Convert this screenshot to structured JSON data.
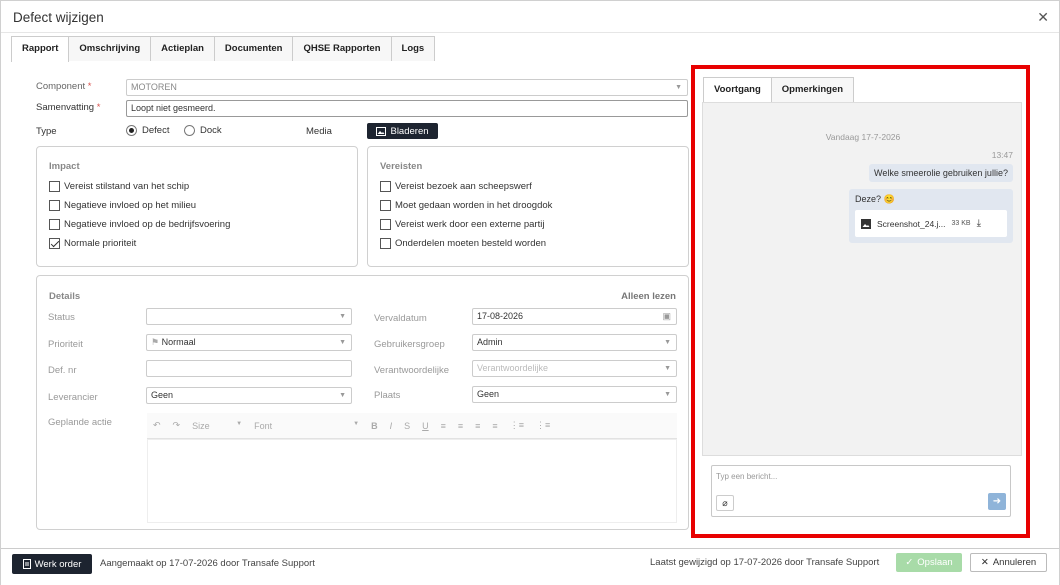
{
  "window": {
    "title": "Defect wijzigen",
    "close_icon": "close-icon"
  },
  "tabs": [
    {
      "label": "Rapport",
      "active": true
    },
    {
      "label": "Omschrijving"
    },
    {
      "label": "Actieplan"
    },
    {
      "label": "Documenten"
    },
    {
      "label": "QHSE Rapporten"
    },
    {
      "label": "Logs"
    }
  ],
  "form": {
    "component_label": "Component",
    "component_req": "*",
    "component_value": "MOTOREN",
    "summary_label": "Samenvatting",
    "summary_req": "*",
    "summary_value": "Loopt niet gesmeerd.",
    "type_label": "Type",
    "type_options": [
      "Defect",
      "Dock"
    ],
    "type_selected": "Defect",
    "media_label": "Media",
    "browse_label": "Bladeren"
  },
  "impact": {
    "title": "Impact",
    "items": [
      {
        "label": "Vereist stilstand van het schip",
        "checked": false
      },
      {
        "label": "Negatieve invloed op het milieu",
        "checked": false
      },
      {
        "label": "Negatieve invloed op de bedrijfsvoering",
        "checked": false
      },
      {
        "label": "Normale prioriteit",
        "checked": true
      }
    ]
  },
  "requirements": {
    "title": "Vereisten",
    "items": [
      {
        "label": "Vereist bezoek aan scheepswerf",
        "checked": false
      },
      {
        "label": "Moet gedaan worden in het droogdok",
        "checked": false
      },
      {
        "label": "Vereist werk door een externe partij",
        "checked": false
      },
      {
        "label": "Onderdelen moeten besteld worden",
        "checked": false
      }
    ]
  },
  "details": {
    "title": "Details",
    "readonly_label": "Alleen lezen",
    "status_label": "Status",
    "status_value": "",
    "priority_label": "Prioriteit",
    "priority_value": "Normaal",
    "defnr_label": "Def. nr",
    "defnr_value": "",
    "supplier_label": "Leverancier",
    "supplier_value": "Geen",
    "planned_action_label": "Geplande actie",
    "due_label": "Vervaldatum",
    "due_value": "17-08-2026",
    "usergroup_label": "Gebruikersgroep",
    "usergroup_value": "Admin",
    "responsible_label": "Verantwoordelijke",
    "responsible_placeholder": "Verantwoordelijke",
    "location_label": "Plaats",
    "location_value": "Geen",
    "toolbar": {
      "size": "Size",
      "font": "Font"
    }
  },
  "right": {
    "tabs": [
      {
        "label": "Voortgang",
        "active": true
      },
      {
        "label": "Opmerkingen"
      }
    ],
    "date_divider": "Vandaag 17-7-2026",
    "messages": [
      {
        "time": "13:47",
        "text": "Welke smeerolie gebruiken jullie?"
      },
      {
        "text": "Deze? 😊",
        "attachment": {
          "name": "Screenshot_24.j...",
          "size": "33 KB"
        }
      }
    ],
    "input_placeholder": "Typ een bericht..."
  },
  "footer": {
    "workorder_label": "Werk order",
    "created_text": "Aangemaakt op 17-07-2026  door  Transafe Support",
    "modified_text": "Laatst gewijzigd op 17-07-2026  door  Transafe Support",
    "save_label": "Opslaan",
    "cancel_label": "Annuleren"
  },
  "colors": {
    "highlight": "#e80000",
    "dark_button": "#1d2430",
    "save_disabled": "#a8dba8",
    "send_button": "#8fb4d9"
  }
}
